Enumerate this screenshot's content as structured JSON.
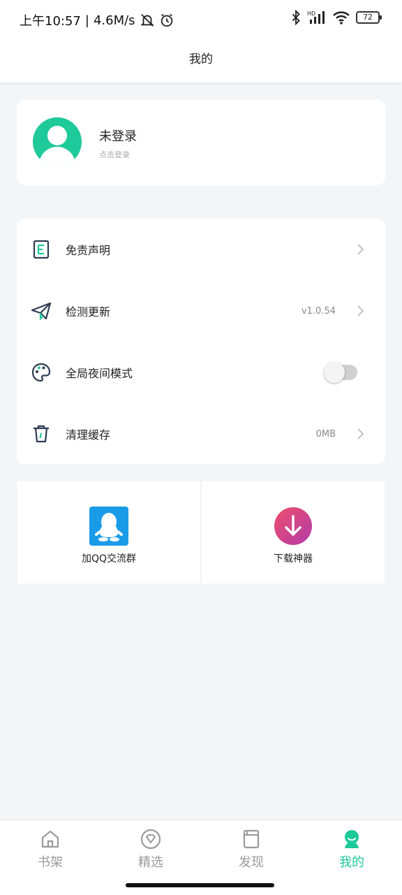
{
  "status_bar": {
    "time": "上午10:57",
    "separator": "|",
    "speed": "4.6M/s",
    "battery": "72",
    "icons": [
      "mute-bell-icon",
      "alarm-icon",
      "bluetooth-icon",
      "signal-icon",
      "wifi-icon",
      "battery-icon"
    ]
  },
  "header": {
    "title": "我的"
  },
  "profile": {
    "name": "未登录",
    "subtitle": "点击登录"
  },
  "menu": {
    "items": [
      {
        "label": "免责声明",
        "value": "",
        "icon": "document-icon"
      },
      {
        "label": "检测更新",
        "value": "v1.0.54",
        "icon": "paper-plane-icon"
      },
      {
        "label": "全局夜间模式",
        "value": "",
        "icon": "palette-icon",
        "toggle": false
      },
      {
        "label": "清理缓存",
        "value": "0MB",
        "icon": "trash-icon"
      }
    ]
  },
  "grid": {
    "items": [
      {
        "label": "加QQ交流群",
        "icon": "qq-icon"
      },
      {
        "label": "下载神器",
        "icon": "download-icon"
      }
    ]
  },
  "tabbar": {
    "tabs": [
      {
        "label": "书架",
        "icon": "bookshelf-icon"
      },
      {
        "label": "精选",
        "icon": "diamond-icon"
      },
      {
        "label": "发现",
        "icon": "discover-book-icon"
      },
      {
        "label": "我的",
        "icon": "profile-icon",
        "active": true
      }
    ]
  },
  "colors": {
    "accent": "#1ec99a",
    "qq_blue": "#1a9be8",
    "download_gradient": [
      "#e6467a",
      "#b53ca6"
    ]
  }
}
